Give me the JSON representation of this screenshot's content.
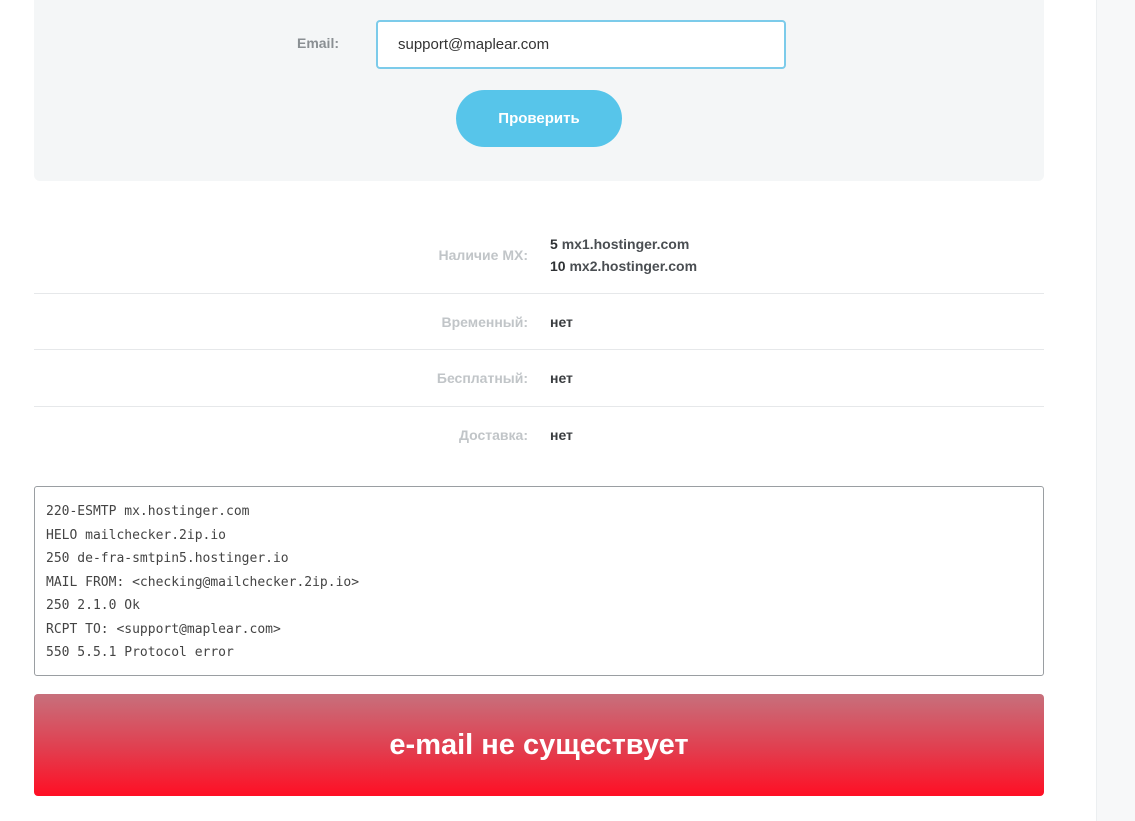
{
  "form": {
    "email_label": "Email:",
    "email_value": "support@maplear.com",
    "check_button_label": "Проверить"
  },
  "results": {
    "mx": {
      "label": "Наличие MX:",
      "records": [
        {
          "priority": "5",
          "host": "mx1.hostinger.com"
        },
        {
          "priority": "10",
          "host": "mx2.hostinger.com"
        }
      ]
    },
    "temporary": {
      "label": "Временный:",
      "value": "нет"
    },
    "free": {
      "label": "Бесплатный:",
      "value": "нет"
    },
    "delivery": {
      "label": "Доставка:",
      "value": "нет"
    }
  },
  "smtp_log": [
    "220-ESMTP mx.hostinger.com",
    "HELO mailchecker.2ip.io",
    "250 de-fra-smtpin5.hostinger.io",
    "MAIL FROM: <checking@mailchecker.2ip.io>",
    "250 2.1.0 Ok",
    "RCPT TO: <support@maplear.com>",
    "550 5.5.1 Protocol error"
  ],
  "verdict": {
    "text": "e-mail не существует",
    "color": "#ff0f24"
  },
  "colors": {
    "accent": "#57c5ea",
    "input_border": "#7ccbea",
    "panel_bg": "#f4f6f7"
  }
}
